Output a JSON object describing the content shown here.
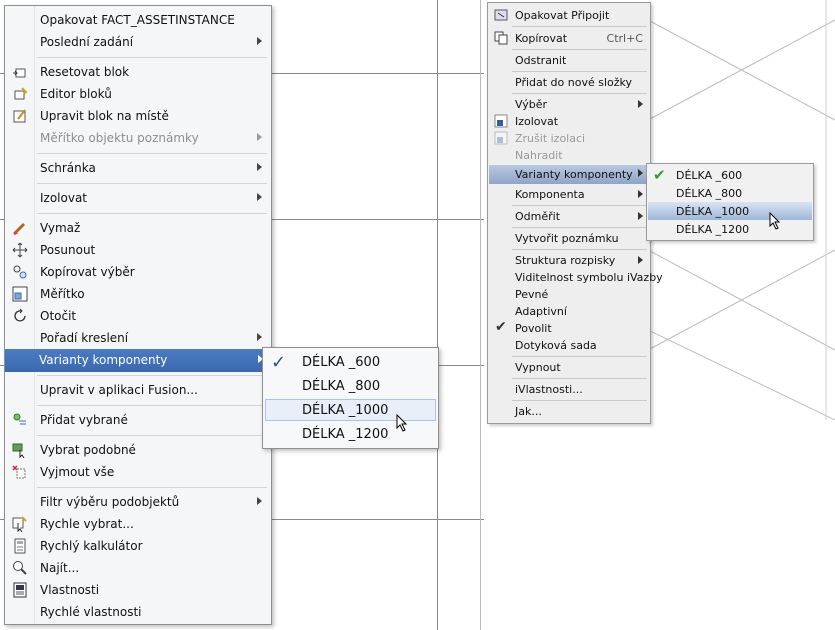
{
  "left_menu": {
    "items": [
      {
        "label": "Opakovat FACT_ASSETINSTANCE",
        "icon": "",
        "submenu": false,
        "disabled": false
      },
      {
        "label": "Poslední zadání",
        "icon": "",
        "submenu": true,
        "disabled": false
      },
      {
        "label": "Resetovat blok",
        "icon": "reset-block-icon",
        "submenu": false,
        "disabled": false
      },
      {
        "label": "Editor bloků",
        "icon": "block-editor-icon",
        "submenu": false,
        "disabled": false
      },
      {
        "label": "Upravit blok na místě",
        "icon": "edit-in-place-icon",
        "submenu": false,
        "disabled": false
      },
      {
        "label": "Měřítko objektu poznámky",
        "icon": "",
        "submenu": true,
        "disabled": true
      },
      {
        "label": "Schránka",
        "icon": "",
        "submenu": true,
        "disabled": false
      },
      {
        "label": "Izolovat",
        "icon": "",
        "submenu": true,
        "disabled": false
      },
      {
        "label": "Vymaž",
        "icon": "eraser-icon",
        "submenu": false,
        "disabled": false
      },
      {
        "label": "Posunout",
        "icon": "move-icon",
        "submenu": false,
        "disabled": false
      },
      {
        "label": "Kopírovat výběr",
        "icon": "copy-selection-icon",
        "submenu": false,
        "disabled": false
      },
      {
        "label": "Měřítko",
        "icon": "scale-icon",
        "submenu": false,
        "disabled": false
      },
      {
        "label": "Otočit",
        "icon": "rotate-icon",
        "submenu": false,
        "disabled": false
      },
      {
        "label": "Pořadí kreslení",
        "icon": "",
        "submenu": true,
        "disabled": false
      },
      {
        "label": "Varianty komponenty",
        "icon": "",
        "submenu": true,
        "disabled": false,
        "highlighted": true
      },
      {
        "label": "Upravit v aplikaci Fusion...",
        "icon": "",
        "submenu": false,
        "disabled": false
      },
      {
        "label": "Přidat vybrané",
        "icon": "add-selected-icon",
        "submenu": false,
        "disabled": false
      },
      {
        "label": "Vybrat podobné",
        "icon": "select-similar-icon",
        "submenu": false,
        "disabled": false
      },
      {
        "label": "Vyjmout vše",
        "icon": "deselect-all-icon",
        "submenu": false,
        "disabled": false
      },
      {
        "label": "Filtr výběru podobjektů",
        "icon": "",
        "submenu": true,
        "disabled": false
      },
      {
        "label": "Rychle vybrat...",
        "icon": "quick-select-icon",
        "submenu": false,
        "disabled": false
      },
      {
        "label": "Rychlý kalkulátor",
        "icon": "calculator-icon",
        "submenu": false,
        "disabled": false
      },
      {
        "label": "Najít...",
        "icon": "find-icon",
        "submenu": false,
        "disabled": false
      },
      {
        "label": "Vlastnosti",
        "icon": "properties-icon",
        "submenu": false,
        "disabled": false
      },
      {
        "label": "Rychlé vlastnosti",
        "icon": "",
        "submenu": false,
        "disabled": false
      }
    ],
    "submenu": {
      "items": [
        {
          "label": "DÉLKA _600",
          "checked": true
        },
        {
          "label": "DÉLKA _800",
          "checked": false
        },
        {
          "label": "DÉLKA _1000",
          "checked": false,
          "hovered": true
        },
        {
          "label": "DÉLKA _1200",
          "checked": false
        }
      ]
    }
  },
  "right_menu": {
    "items": [
      {
        "label": "Opakovat Připojit",
        "icon": "attach-icon"
      },
      {
        "label": "Kopírovat",
        "icon": "copy-icon",
        "shortcut": "Ctrl+C"
      },
      {
        "label": "Odstranit",
        "icon": ""
      },
      {
        "label": "Přidat do nové složky",
        "icon": ""
      },
      {
        "label": "Výběr",
        "icon": "",
        "submenu": true
      },
      {
        "label": "Izolovat",
        "icon": "isolate-icon"
      },
      {
        "label": "Zrušit izolaci",
        "icon": "unisolate-icon",
        "disabled": true
      },
      {
        "label": "Nahradit",
        "icon": "",
        "disabled": true
      },
      {
        "label": "Varianty komponenty",
        "icon": "",
        "submenu": true,
        "highlighted": true
      },
      {
        "label": "Komponenta",
        "icon": "",
        "submenu": true
      },
      {
        "label": "Odměřit",
        "icon": "",
        "submenu": true
      },
      {
        "label": "Vytvořit poznámku",
        "icon": ""
      },
      {
        "label": "Struktura rozpisky",
        "icon": "",
        "submenu": true
      },
      {
        "label": "Viditelnost symbolu iVazby",
        "icon": ""
      },
      {
        "label": "Pevné",
        "icon": ""
      },
      {
        "label": "Adaptivní",
        "icon": ""
      },
      {
        "label": "Povolit",
        "icon": "check-icon"
      },
      {
        "label": "Dotyková sada",
        "icon": ""
      },
      {
        "label": "Vypnout",
        "icon": ""
      },
      {
        "label": "iVlastnosti...",
        "icon": ""
      },
      {
        "label": "Jak...",
        "icon": ""
      }
    ],
    "submenu": {
      "items": [
        {
          "label": "DÉLKA _600",
          "checked": true
        },
        {
          "label": "DÉLKA _800",
          "checked": false
        },
        {
          "label": "DÉLKA _1000",
          "checked": false,
          "highlighted": true
        },
        {
          "label": "DÉLKA _1200",
          "checked": false
        }
      ]
    }
  }
}
